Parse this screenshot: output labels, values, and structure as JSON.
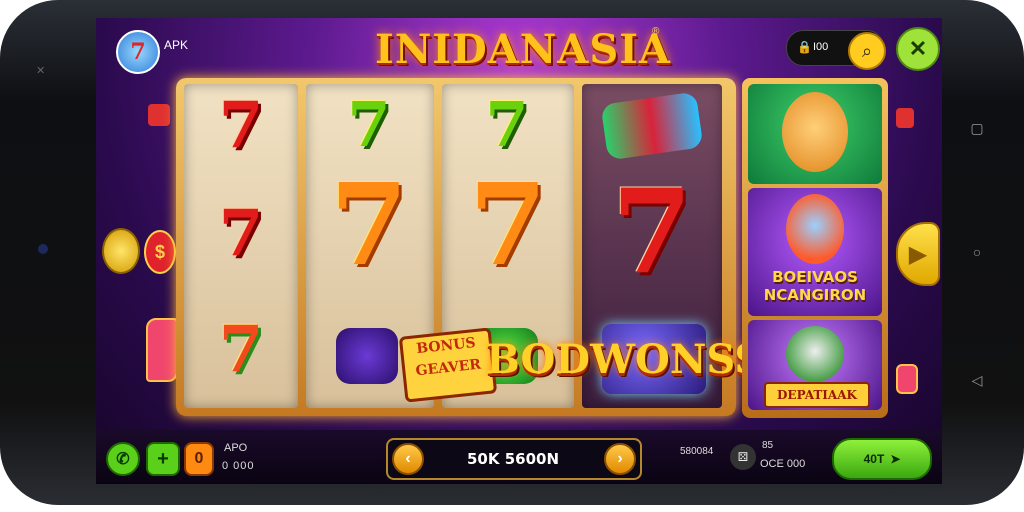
{
  "header": {
    "badge_text": "7",
    "apk_label": "APK",
    "title": "INIDANASIA",
    "title_mark": "®",
    "coin_value": "I00",
    "search_icon": "search-icon",
    "close_icon": "close-icon"
  },
  "reels": {
    "bonus_small_line1": "BONUS",
    "bonus_small_line2": "GEAVER",
    "bonus_big": "BODWONSS!"
  },
  "side_panel": {
    "card2_line1": "BOEIVAOS",
    "card2_line2": "NCANGIRON",
    "card3_label": "DEPATIAAK"
  },
  "bottom": {
    "apo_label": "APO",
    "apo_value": "0 000",
    "zero_btn": "0",
    "bet_value": "50K 5600N",
    "left_stat": "580084",
    "right_stat_top": "85",
    "right_stat_bottom": "OCE 000",
    "spin_label": "40T"
  },
  "colors": {
    "title_gold": "#ffc21a",
    "bg_purple": "#5c1a8e",
    "accent_green": "#5bd01a",
    "accent_orange": "#ff8a12"
  }
}
